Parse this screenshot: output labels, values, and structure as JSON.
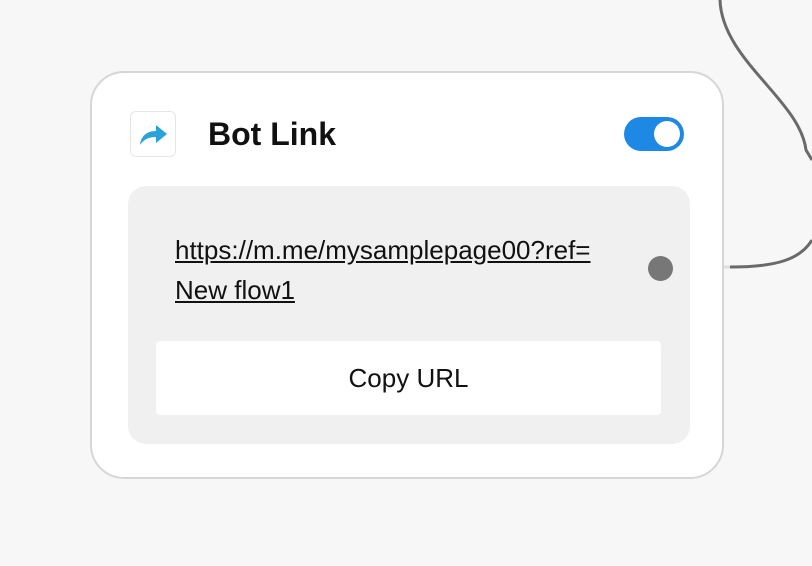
{
  "node": {
    "title": "Bot Link",
    "icon": "share-arrow-icon",
    "enabled": true,
    "url_text": "https://m.me/mysamplepage00?ref=New flow1",
    "copy_button_label": "Copy URL"
  },
  "colors": {
    "canvas_background": "#f7f7f7",
    "card_border": "#d6d6d6",
    "panel_background": "#f0f0f0",
    "toggle_on": "#1e88e5",
    "icon_blue": "#29a3d8",
    "port": "#777777",
    "connector": "#6a6a6a"
  }
}
